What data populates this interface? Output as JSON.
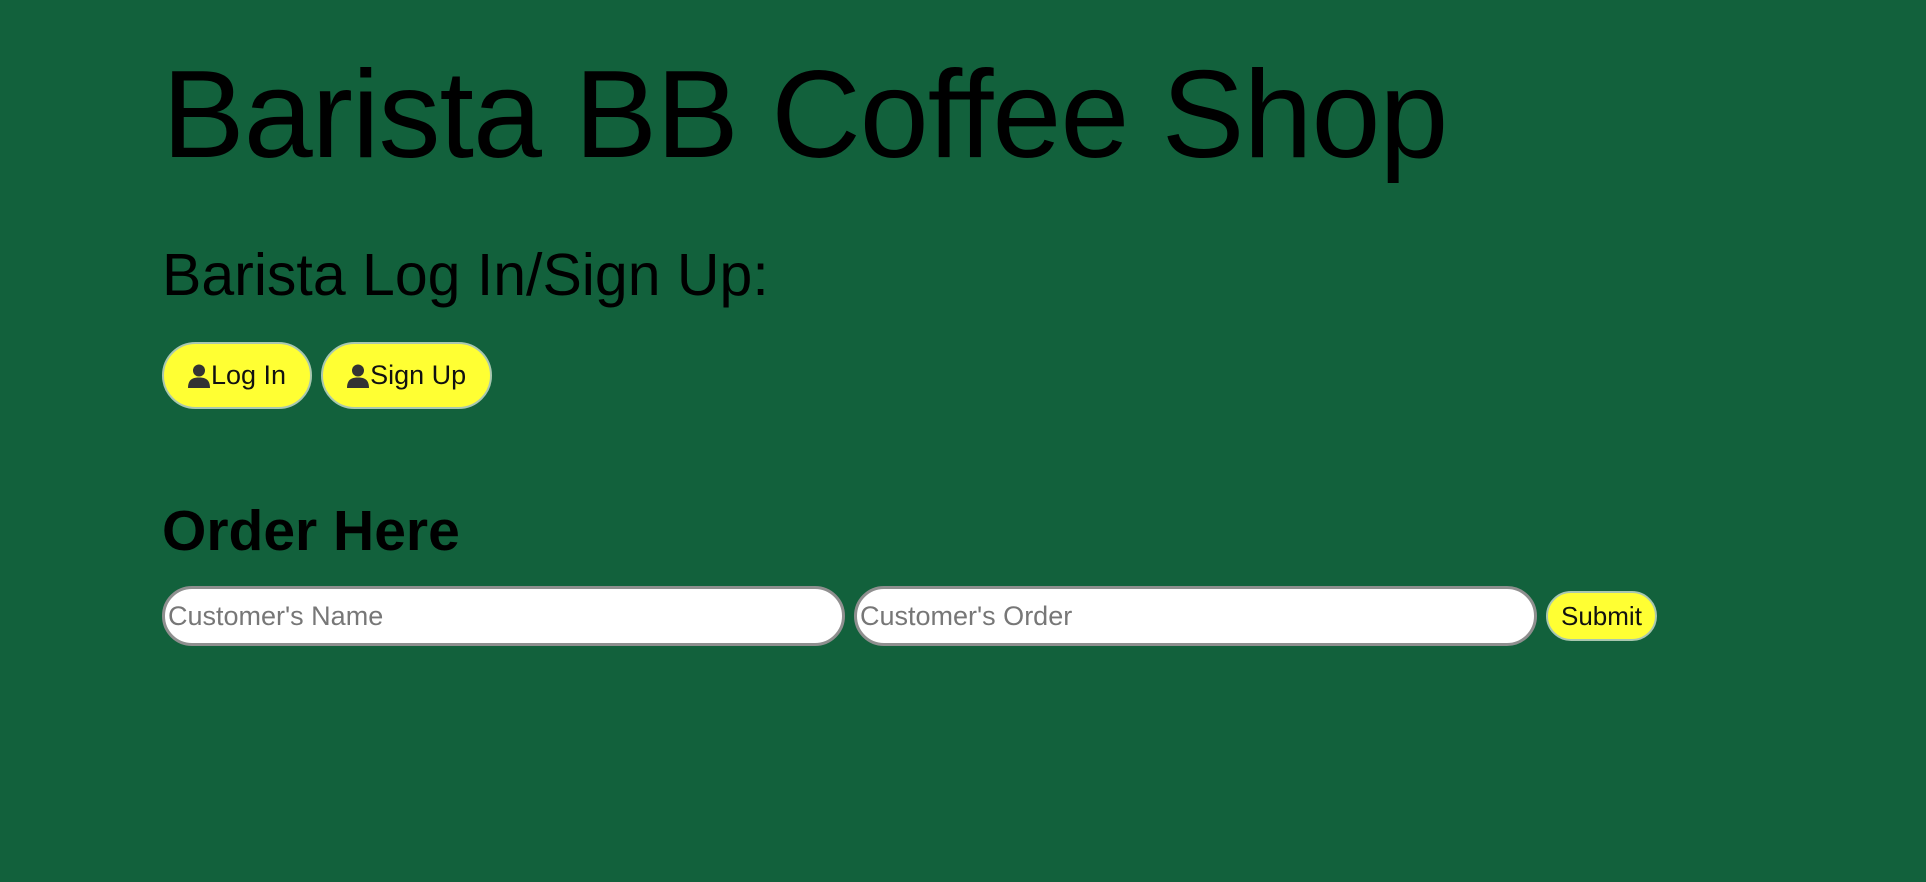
{
  "header": {
    "title": "Barista BB Coffee Shop"
  },
  "auth": {
    "heading": "Barista Log In/Sign Up:",
    "login_label": "Log In",
    "signup_label": "Sign Up",
    "icon": "user-icon"
  },
  "order": {
    "heading": "Order Here",
    "name_placeholder": "Customer's Name",
    "name_value": "",
    "order_placeholder": "Customer's Order",
    "order_value": "",
    "submit_label": "Submit"
  },
  "colors": {
    "background": "#12613c",
    "button": "#ffff33",
    "text": "#000000"
  }
}
